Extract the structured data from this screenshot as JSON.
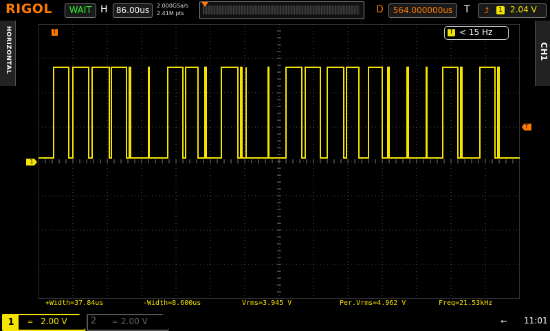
{
  "brand": "RIGOL",
  "acq_status": "WAIT",
  "horizontal": {
    "label": "H",
    "timebase": "86.00us"
  },
  "sample_rate": "2.000GSa/s",
  "mem_depth": "2.41M pts",
  "delay": {
    "label": "D",
    "value": "564.000000us"
  },
  "trigger": {
    "label": "T",
    "source_badge": "1",
    "level": "2.04 V"
  },
  "side_tabs": {
    "left": "HORIZONTAL",
    "right": "CH1"
  },
  "trigger_freq": {
    "badge": "T",
    "text": "< 15 Hz"
  },
  "markers": {
    "ch1": "1",
    "trigger_level": "T",
    "trigger_pos": "T"
  },
  "measurements": [
    "+Width=37.84us",
    "-Width=8.600us",
    "Vrms=3.945 V",
    "Per.Vrms=4.962 V",
    "Freq=21.53kHz"
  ],
  "channels": {
    "ch1": {
      "num": "1",
      "scale": "2.00 V",
      "coupling": "DC",
      "color": "#f5e400"
    },
    "ch2": {
      "num": "2",
      "scale": "2.00 V",
      "color": "#666666"
    }
  },
  "clock": "11:01",
  "colors": {
    "accent": "#ff7a00",
    "trace": "#f5e400",
    "grid": "#5a5a5a",
    "status": "#2ee82e"
  }
}
